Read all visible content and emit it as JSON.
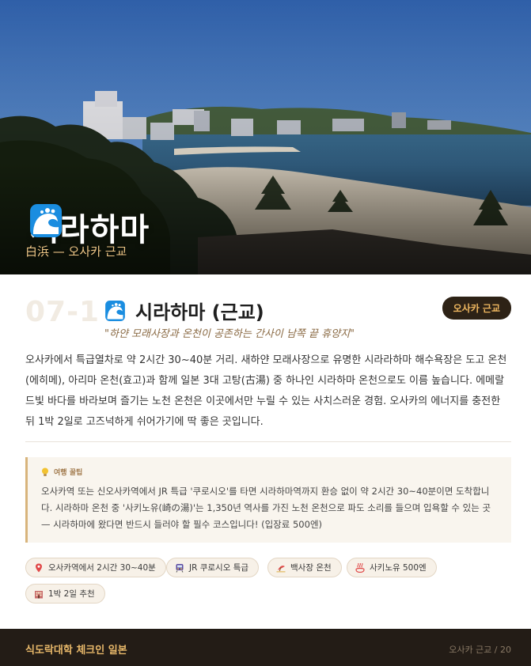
{
  "hero": {
    "title": "시라하마",
    "subtitle": "白浜 — 오사카 근교",
    "icon": "wave-icon"
  },
  "header": {
    "number": "07-1",
    "title": "시라하마 (근교)",
    "badge": "오사카 근교",
    "tagline": "\"하얀 모래사장과 온천이 공존하는 간사이 남쪽 끝 휴양지\""
  },
  "description": "오사카에서 특급열차로 약 2시간 30~40분 거리. 새하얀 모래사장으로 유명한 시라라하마 해수욕장은 도고 온천(에히메), 아리마 온천(효고)과 함께 일본 3대 고탕(古湯) 중 하나인 시라하마 온천으로도 이름 높습니다. 에메랄드빛 바다를 바라보며 즐기는 노천 온천은 이곳에서만 누릴 수 있는 사치스러운 경험. 오사카의 에너지를 충전한 뒤 1박 2일로 고즈넉하게 쉬어가기에 딱 좋은 곳입니다.",
  "tip": {
    "label": "여행 꿀팁",
    "icon": "lightbulb-icon",
    "text": "오사카역 또는 신오사카역에서 JR 특급 '쿠로시오'를 타면 시라하마역까지 환승 없이 약 2시간 30~40분이면 도착합니다. 시라하마 온천 중 '사키노유(崎の湯)'는 1,350년 역사를 가진 노천 온천으로 파도 소리를 들으며 입욕할 수 있는 곳 — 시라하마에 왔다면 반드시 들러야 할 필수 코스입니다! (입장료 500엔)"
  },
  "chips": [
    {
      "icon": "pin-icon",
      "label": "오사카역에서 2시간 30~40분"
    },
    {
      "icon": "train-icon",
      "label": "JR 쿠로시오 특급"
    },
    {
      "icon": "beach-icon",
      "label": "백사장 온천"
    },
    {
      "icon": "hot-spring-icon",
      "label": "사키노유 500엔"
    },
    {
      "icon": "hotel-icon",
      "label": "1박 2일 추천"
    }
  ],
  "footer": {
    "brand": "식도락대학 체크인 일본",
    "page": "오사카 근교 / 20"
  },
  "colors": {
    "accent": "#e8b86a",
    "dark": "#231c16",
    "icon_blue": "#1a8de0"
  }
}
